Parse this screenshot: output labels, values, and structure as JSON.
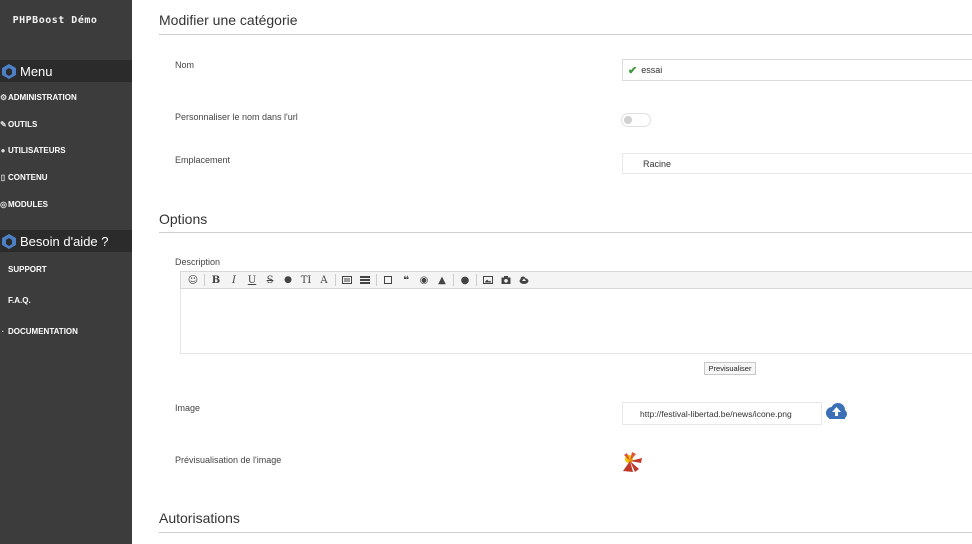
{
  "sidebar": {
    "site_title": "PHPBoost Démo",
    "menu_title": "Menu",
    "menu_items": [
      {
        "label": "ADMINISTRATION",
        "icon": "cog-icon"
      },
      {
        "label": "OUTILS",
        "icon": "wrench-icon"
      },
      {
        "label": "UTILISATEURS",
        "icon": "user-icon"
      },
      {
        "label": "CONTENU",
        "icon": "file-icon"
      },
      {
        "label": "MODULES",
        "icon": "cube-icon"
      }
    ],
    "help_title": "Besoin d'aide ?",
    "help_items": [
      {
        "label": "SUPPORT"
      },
      {
        "label": "F.A.Q."
      },
      {
        "label": "DOCUMENTATION"
      }
    ]
  },
  "category": {
    "section_title": "Modifier une catégorie",
    "name_label": "Nom",
    "name_value": "essai",
    "url_label": "Personnaliser le nom dans l'url",
    "location_label": "Emplacement",
    "location_value": "Racine"
  },
  "options": {
    "section_title": "Options",
    "description_label": "Description",
    "preview_button": "Previsualiser",
    "image_label": "Image",
    "image_value": "http://festival-libertad.be/news/icone.png",
    "image_preview_label": "Prévisualisation de l'image"
  },
  "authorizations": {
    "section_title": "Autorisations"
  },
  "colors": {
    "sidebar_bg": "#3c3c3c",
    "accent_blue": "#3b6fb6",
    "valid_green": "#3a9a3a"
  }
}
